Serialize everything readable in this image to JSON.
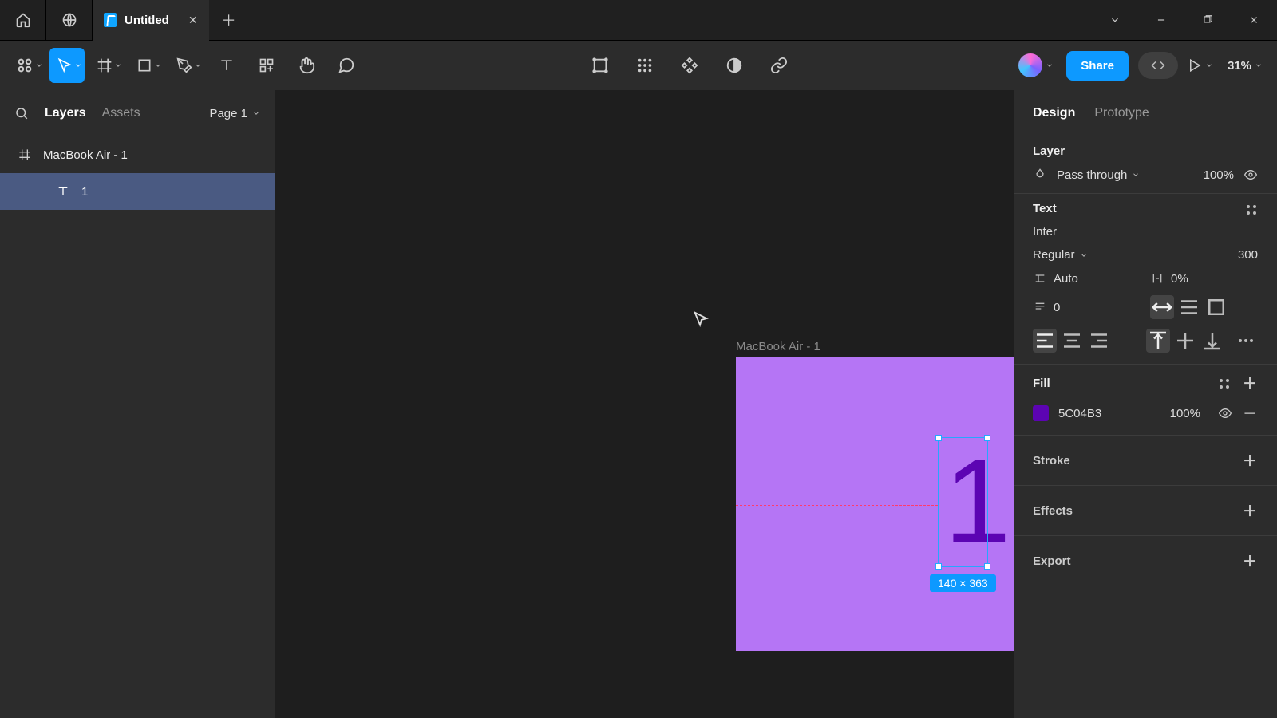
{
  "titlebar": {
    "doc_title": "Untitled"
  },
  "toolbar": {
    "share_label": "Share",
    "zoom": "31%"
  },
  "left": {
    "tabs": {
      "layers": "Layers",
      "assets": "Assets"
    },
    "page_label": "Page 1",
    "frame_name": "MacBook Air - 1",
    "text_layer_name": "1"
  },
  "canvas": {
    "frame_label": "MacBook Air - 1",
    "glyph": "1",
    "selection_dims": "140 × 363"
  },
  "right": {
    "tabs": {
      "design": "Design",
      "prototype": "Prototype"
    },
    "layer": {
      "title": "Layer",
      "blend_mode": "Pass through",
      "opacity": "100%"
    },
    "text": {
      "title": "Text",
      "font_family": "Inter",
      "font_weight": "Regular",
      "font_size": "300",
      "line_height": "Auto",
      "letter_spacing": "0%",
      "paragraph_spacing": "0"
    },
    "fill": {
      "title": "Fill",
      "hex": "5C04B3",
      "opacity": "100%"
    },
    "stroke": {
      "title": "Stroke"
    },
    "effects": {
      "title": "Effects"
    },
    "export": {
      "title": "Export"
    }
  }
}
